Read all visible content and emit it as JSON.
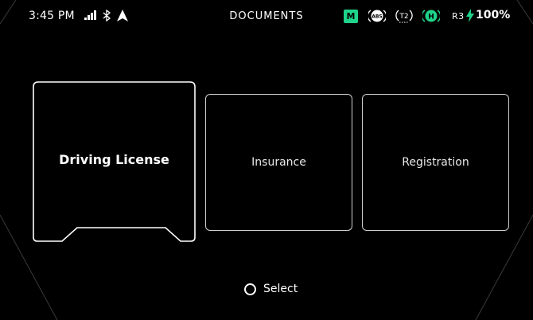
{
  "status_bar": {
    "time": "3:45 PM",
    "title": "DOCUMENTS",
    "mode_badge": "M",
    "abs_label": "ABS",
    "t2_label": "T2",
    "h_label": "H",
    "gear": "R3",
    "battery": "100%",
    "icons": [
      "signal-icon",
      "bluetooth-icon",
      "navigation-icon",
      "abs-icon",
      "traction-control-icon",
      "headlight-icon",
      "charging-bolt-icon"
    ],
    "accent_color": "#1fd38a"
  },
  "documents": [
    {
      "label": "Driving License",
      "selected": true
    },
    {
      "label": "Insurance",
      "selected": false
    },
    {
      "label": "Registration",
      "selected": false
    }
  ],
  "hint": {
    "label": "Select"
  }
}
